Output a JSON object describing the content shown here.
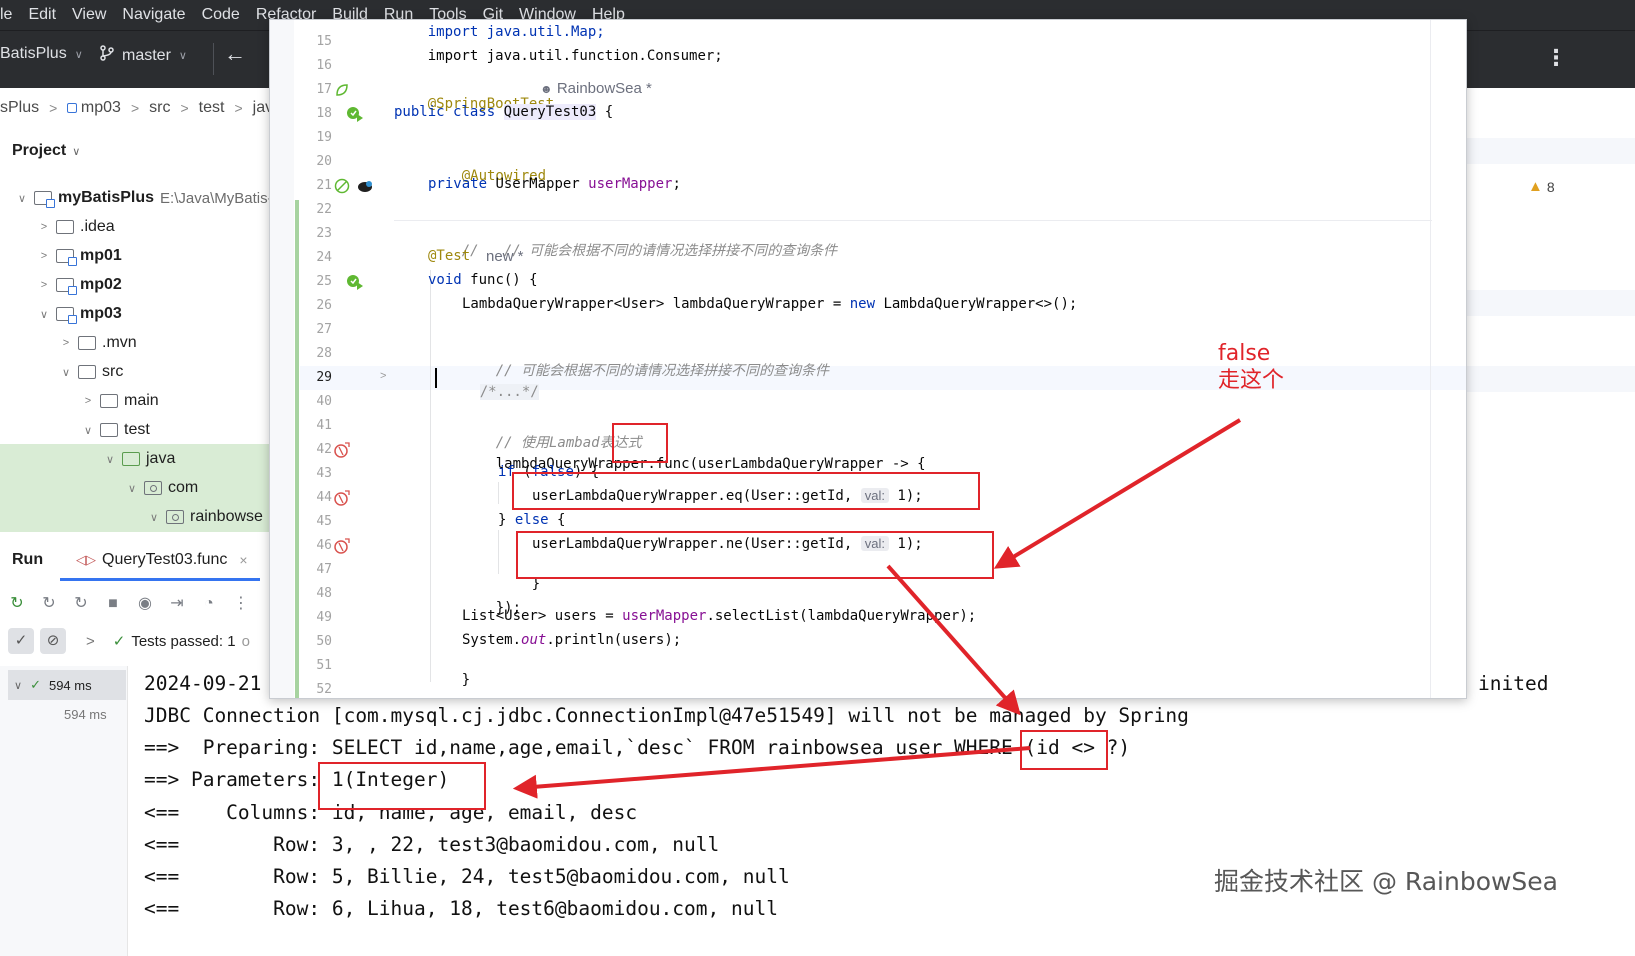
{
  "menubar": {
    "items": [
      "le",
      "Edit",
      "View",
      "Navigate",
      "Code",
      "Refactor",
      "Build",
      "Run",
      "Tools",
      "Git",
      "Window",
      "Help"
    ]
  },
  "toolbar": {
    "project": "BatisPlus",
    "branch": "master"
  },
  "breadcrumb": [
    "sPlus",
    "mp03",
    "src",
    "test",
    "java"
  ],
  "project_panel": {
    "title": "Project",
    "tree": [
      {
        "label": "myBatisPlus",
        "path": "E:\\Java\\MyBatis-"
      },
      {
        "label": ".idea"
      },
      {
        "label": "mp01"
      },
      {
        "label": "mp02"
      },
      {
        "label": "mp03"
      },
      {
        "label": ".mvn"
      },
      {
        "label": "src"
      },
      {
        "label": "main"
      },
      {
        "label": "test"
      },
      {
        "label": "java"
      },
      {
        "label": "com"
      },
      {
        "label": "rainbowse"
      }
    ]
  },
  "run_panel": {
    "title": "Run",
    "tab": "QueryTest03.func",
    "tests_passed": "Tests passed: 1",
    "tests_passed_tail": "o",
    "result_time": "594 ms",
    "sub_time": "594 ms"
  },
  "editor": {
    "line_numbers": [
      "15",
      "16",
      "17",
      "18",
      "19",
      "20",
      "21",
      "22",
      "23",
      "24",
      "25",
      "26",
      "27",
      "28",
      "29",
      "40",
      "41",
      "42",
      "43",
      "44",
      "45",
      "46",
      "47",
      "48",
      "49",
      "50",
      "51",
      "52"
    ],
    "lines": {
      "l14": "import java.util.Map;",
      "l15": "import java.util.function.Consumer;",
      "l17": "@SpringBootTest",
      "l17_author": "RainbowSea *",
      "l18_a": "public class ",
      "l18_b": "QueryTest03",
      "l18_c": " {",
      "l20": "@Autowired",
      "l21_a": "private ",
      "l21_b": "UserMapper ",
      "l21_c": "userMapper",
      "l21_d": ";",
      "l23": "//   // 可能会根据不同的请情况选择拼接不同的查询条件",
      "l24_a": "@Test",
      "l24_b": "new *",
      "l25_a": "void ",
      "l25_b": "func() {",
      "l26_a": "LambdaQueryWrapper<User> lambdaQueryWrapper = ",
      "l26_b": "new ",
      "l26_c": "LambdaQueryWrapper<>();",
      "l28": "// 可能会根据不同的请情况选择拼接不同的查询条件",
      "l29": "/*...*/",
      "l41": "// 使用Lambad表达式",
      "l42": "lambdaQueryWrapper.func(userLambdaQueryWrapper -> {",
      "l43_a": "if ",
      "l43_b": "(",
      "l43_c": "false",
      "l43_d": ") {",
      "l44_a": "userLambdaQueryWrapper.eq(User::getId,",
      "l44_hint": "val:",
      "l44_b": "1);",
      "l45_a": "} ",
      "l45_b": "else",
      "l45_c": " {",
      "l46_a": "userLambdaQueryWrapper.ne(User::getId,",
      "l46_hint": "val:",
      "l46_b": "1);",
      "l47": "}",
      "l48": "});",
      "l49_a": "List<User> users = ",
      "l49_b": "userMapper",
      "l49_c": ".selectList(lambdaQueryWrapper);",
      "l50_a": "System.",
      "l50_b": "out",
      "l50_c": ".println(users);",
      "l51": "}"
    }
  },
  "console": {
    "lines": [
      "2024-09-21",
      "JDBC Connection [com.mysql.cj.jdbc.ConnectionImpl@47e51549] will not be managed by Spring",
      "==>  Preparing: SELECT id,name,age,email,`desc` FROM rainbowsea_user WHERE (id <> ?)",
      "==> Parameters: 1(Integer)",
      "<==    Columns: id, name, age, email, desc",
      "<==        Row: 3, , 22, test3@baomidou.com, null",
      "<==        Row: 5, Billie, 24, test5@baomidou.com, null",
      "<==        Row: 6, Lihua, 18, test6@baomidou.com, null"
    ],
    "right_text": "inited"
  },
  "warnings": "8",
  "annotation": {
    "line1": "false",
    "line2": "走这个"
  },
  "watermark": "掘金技术社区 @ RainbowSea",
  "colors": {
    "annotation_red": "#e0242a",
    "chrome_dark": "#2b2d30",
    "keyword": "#0033b3",
    "annotation_yellow": "#9e880d",
    "field": "#871094"
  }
}
